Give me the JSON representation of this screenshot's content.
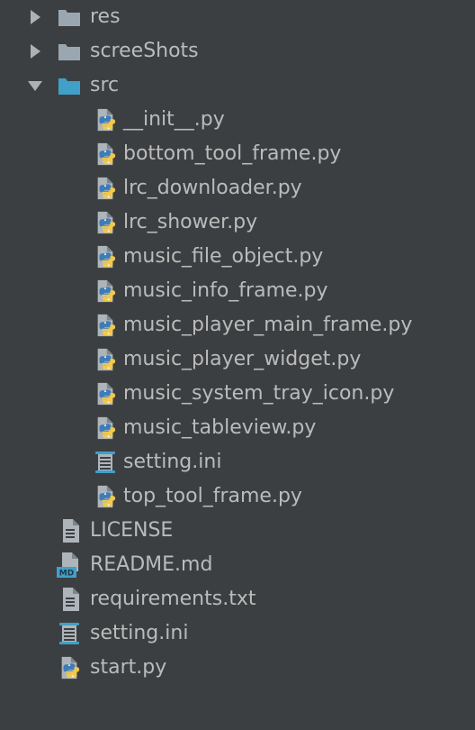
{
  "tree": {
    "folders": [
      {
        "name": "res",
        "expanded": false,
        "icon": "folder-icon"
      },
      {
        "name": "screeShots",
        "expanded": false,
        "icon": "folder-icon"
      },
      {
        "name": "src",
        "expanded": true,
        "icon": "source-folder-icon"
      }
    ],
    "src_files": [
      {
        "name": "__init__.py",
        "icon": "python-file-icon"
      },
      {
        "name": "bottom_tool_frame.py",
        "icon": "python-file-icon"
      },
      {
        "name": "lrc_downloader.py",
        "icon": "python-file-icon"
      },
      {
        "name": "lrc_shower.py",
        "icon": "python-file-icon"
      },
      {
        "name": "music_file_object.py",
        "icon": "python-file-icon"
      },
      {
        "name": "music_info_frame.py",
        "icon": "python-file-icon"
      },
      {
        "name": "music_player_main_frame.py",
        "icon": "python-file-icon"
      },
      {
        "name": "music_player_widget.py",
        "icon": "python-file-icon"
      },
      {
        "name": "music_system_tray_icon.py",
        "icon": "python-file-icon"
      },
      {
        "name": "music_tableview.py",
        "icon": "python-file-icon"
      },
      {
        "name": "setting.ini",
        "icon": "ini-file-icon"
      },
      {
        "name": "top_tool_frame.py",
        "icon": "python-file-icon"
      }
    ],
    "root_files": [
      {
        "name": "LICENSE",
        "icon": "text-file-icon"
      },
      {
        "name": "README.md",
        "icon": "markdown-file-icon"
      },
      {
        "name": "requirements.txt",
        "icon": "text-file-icon"
      },
      {
        "name": "setting.ini",
        "icon": "ini-file-icon"
      },
      {
        "name": "start.py",
        "icon": "python-file-icon"
      }
    ]
  },
  "colors": {
    "background": "#3c3f41",
    "text": "#bbbbbb",
    "folder": "#9aa7b0",
    "source_folder": "#40a0c8",
    "python_blue": "#3e7cb8",
    "python_yellow": "#f2c94c"
  },
  "md_badge": "MD"
}
